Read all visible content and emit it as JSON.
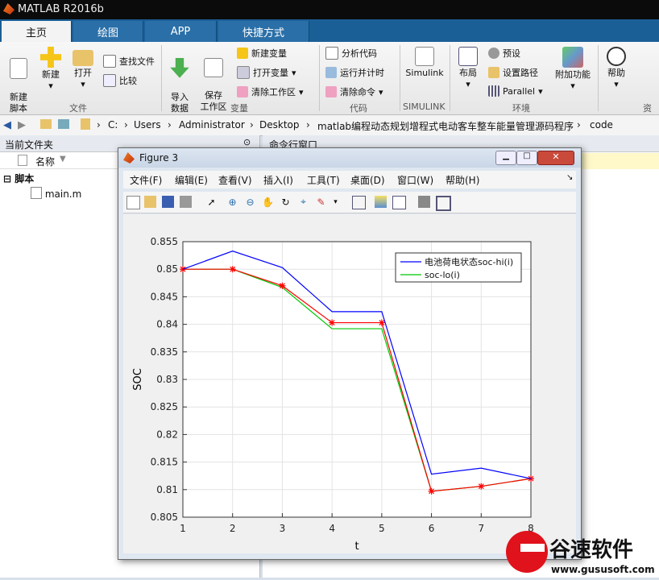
{
  "app": {
    "title": "MATLAB R2016b"
  },
  "tabs": [
    {
      "label": "主页",
      "active": true
    },
    {
      "label": "绘图",
      "active": false
    },
    {
      "label": "APP",
      "active": false
    },
    {
      "label": "快捷方式",
      "active": false
    }
  ],
  "ribbon": {
    "new_script": "新建\n脚本",
    "new": "新建",
    "open": "打开",
    "find_files": "查找文件",
    "compare": "比较",
    "group_file": "文件",
    "import_data": "导入\n数据",
    "save_workspace": "保存\n工作区",
    "new_variable": "新建变量",
    "open_variable": "打开变量",
    "clear_workspace": "清除工作区",
    "group_variable": "变量",
    "analyze_code": "分析代码",
    "run_and_time": "运行并计时",
    "clear_commands": "清除命令",
    "group_code": "代码",
    "simulink": "Simulink",
    "group_simulink": "SIMULINK",
    "layout": "布局",
    "preferences": "预设",
    "set_path": "设置路径",
    "parallel": "Parallel",
    "group_env": "环境",
    "addons": "附加功能",
    "help": "帮助",
    "group_resources": "资源"
  },
  "address": {
    "crumbs": [
      "C:",
      "Users",
      "Administrator",
      "Desktop",
      "matlab编程动态规划增程式电动客车整车能量管理源码程序",
      "code"
    ]
  },
  "current_folder": {
    "title": "当前文件夹",
    "col_name": "名称",
    "group": "脚本",
    "files": [
      "main.m"
    ]
  },
  "command_window": {
    "title": "命令行窗口"
  },
  "figure": {
    "title": "Figure 3",
    "menus": [
      "文件(F)",
      "编辑(E)",
      "查看(V)",
      "插入(I)",
      "工具(T)",
      "桌面(D)",
      "窗口(W)",
      "帮助(H)"
    ]
  },
  "chart_data": {
    "type": "line",
    "xlabel": "t",
    "ylabel": "SOC",
    "xlim": [
      1,
      8
    ],
    "ylim": [
      0.805,
      0.855
    ],
    "xticks": [
      "1",
      "2",
      "3",
      "4",
      "5",
      "6",
      "7",
      "8"
    ],
    "yticks": [
      "0.805",
      "0.81",
      "0.815",
      "0.82",
      "0.825",
      "0.83",
      "0.835",
      "0.84",
      "0.845",
      "0.85",
      "0.855"
    ],
    "grid": true,
    "legend_position": "top-right",
    "x": [
      1,
      2,
      3,
      4,
      5,
      6,
      7,
      8
    ],
    "series": [
      {
        "name": "电池荷电状态soc-hi(i)",
        "color": "#0000ff",
        "values": [
          0.85,
          0.8533,
          0.8503,
          0.8423,
          0.8423,
          0.8128,
          0.8139,
          0.812
        ]
      },
      {
        "name": "soc-lo(i)",
        "color": "#00c800",
        "values": [
          0.85,
          0.85,
          0.8467,
          0.8392,
          0.8392,
          0.8097,
          0.8106,
          0.812
        ]
      },
      {
        "name": "",
        "color": "#ff0000",
        "marker": "*",
        "values": [
          0.85,
          0.85,
          0.847,
          0.8403,
          0.8403,
          0.8097,
          0.8106,
          0.812
        ]
      }
    ]
  },
  "watermark": {
    "brand": "谷速软件",
    "url": "www.gususoft.com"
  }
}
